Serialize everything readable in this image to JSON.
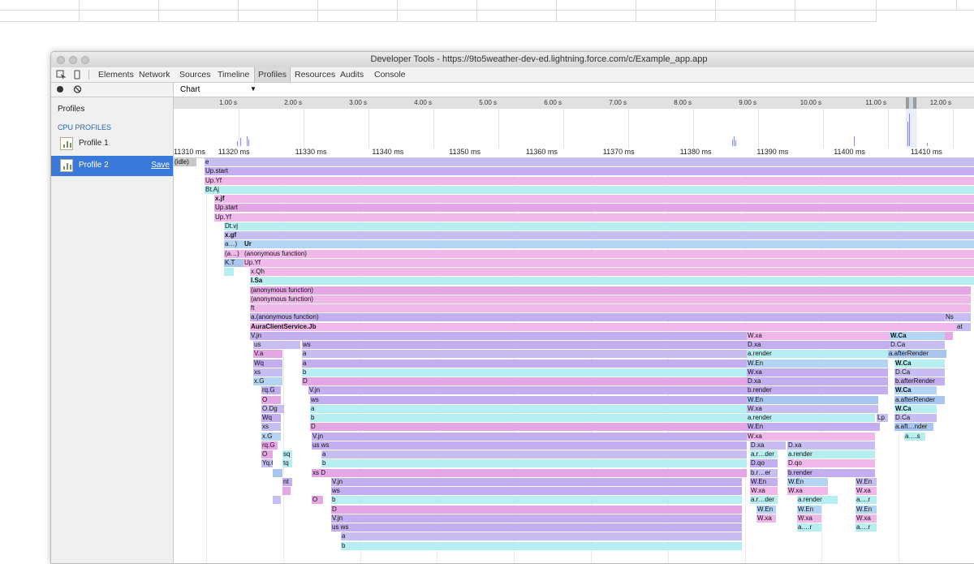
{
  "window": {
    "title": "Developer Tools - https://9to5weather-dev-ed.lightning.force.com/c/Example_app.app"
  },
  "tabs": [
    {
      "label": "Elements",
      "name": "tab-elements"
    },
    {
      "label": "Network",
      "name": "tab-network"
    },
    {
      "label": "Sources",
      "name": "tab-sources"
    },
    {
      "label": "Timeline",
      "name": "tab-timeline"
    },
    {
      "label": "Profiles",
      "name": "tab-profiles",
      "active": true
    },
    {
      "label": "Resources",
      "name": "tab-resources"
    },
    {
      "label": "Audits",
      "name": "tab-audits"
    },
    {
      "label": "Console",
      "name": "tab-console"
    }
  ],
  "sidebar": {
    "profiles_label": "Profiles",
    "cpu_header": "CPU PROFILES",
    "items": [
      {
        "label": "Profile 1"
      },
      {
        "label": "Profile 2",
        "save": "Save"
      }
    ]
  },
  "view": {
    "selected": "Chart"
  },
  "overview": {
    "labels": [
      "1.00 s",
      "2.00 s",
      "3.00 s",
      "4.00 s",
      "5.00 s",
      "6.00 s",
      "7.00 s",
      "8.00 s",
      "9.00 s",
      "10.00 s",
      "11.00 s",
      "12.00 s"
    ]
  },
  "flame_ruler": {
    "labels": [
      "11310 ms",
      "11320 ms",
      "11330 ms",
      "11340 ms",
      "11350 ms",
      "11360 ms",
      "11370 ms",
      "11380 ms",
      "11390 ms",
      "11400 ms",
      "11410 ms"
    ]
  },
  "colors": {
    "lavender": "#c7bdf0",
    "pink": "#f0b8ea",
    "cyan": "#b6eef2",
    "blue": "#b3d4f2",
    "violet": "#c3aef0",
    "magenta": "#e5a6e6",
    "sky": "#a9c6f0",
    "gray": "#c8c8c8"
  },
  "flame": [
    [
      "(idle)",
      0,
      28,
      0,
      "gray"
    ],
    [
      "e",
      38,
      962,
      0,
      "lavender"
    ],
    [
      "Up.start",
      38,
      962,
      1,
      "violet"
    ],
    [
      "Up.Yf",
      38,
      962,
      2,
      "pink"
    ],
    [
      "Bt.Aj",
      38,
      962,
      3,
      "cyan"
    ],
    [
      "x.jf",
      50,
      950,
      4,
      "pink",
      "b"
    ],
    [
      "Up.start",
      50,
      950,
      5,
      "magenta"
    ],
    [
      "Up.Yf",
      50,
      950,
      6,
      "pink"
    ],
    [
      "Dt.vj",
      62,
      938,
      7,
      "cyan"
    ],
    [
      "x.gf",
      62,
      938,
      8,
      "lavender",
      "b"
    ],
    [
      "a…)",
      62,
      24,
      9,
      "blue"
    ],
    [
      "Ur",
      86,
      914,
      9,
      "blue",
      "b"
    ],
    [
      "(a…)",
      62,
      24,
      10,
      "pink"
    ],
    [
      "(anonymous function)",
      86,
      914,
      10,
      "pink"
    ],
    [
      "K.T",
      62,
      24,
      11,
      "sky"
    ],
    [
      "Up.Yf",
      86,
      914,
      11,
      "pink"
    ],
    [
      "",
      62,
      12,
      12,
      "cyan"
    ],
    [
      "x.Qh",
      94,
      906,
      12,
      "pink"
    ],
    [
      "I.Sa",
      94,
      906,
      13,
      "cyan",
      "b"
    ],
    [
      "(anonymous function)",
      94,
      888,
      14,
      "magenta"
    ],
    [
      "(anonymous function)",
      94,
      888,
      15,
      "pink"
    ],
    [
      "ft",
      94,
      888,
      16,
      "pink"
    ],
    [
      "a.(anonymous function)",
      94,
      856,
      17,
      "violet"
    ],
    [
      "Ns",
      950,
      32,
      17,
      "lavender"
    ],
    [
      "AuraClientService.Jb",
      94,
      870,
      18,
      "pink",
      "b"
    ],
    [
      "at",
      964,
      18,
      18,
      "lavender"
    ],
    [
      "V.jn",
      94,
      612,
      19,
      "violet"
    ],
    [
      "W.xa",
      706,
      176,
      19,
      "pink"
    ],
    [
      "W.Ca",
      882,
      68,
      19,
      "blue",
      "b"
    ],
    [
      "",
      950,
      10,
      19,
      "magenta"
    ],
    [
      "us",
      98,
      58,
      20,
      "lavender"
    ],
    [
      "ws",
      158,
      548,
      20,
      "violet"
    ],
    [
      "D.xa",
      706,
      176,
      20,
      "violet"
    ],
    [
      "D.Ca",
      882,
      68,
      20,
      "lavender"
    ],
    [
      "V.a",
      98,
      36,
      21,
      "magenta"
    ],
    [
      "a",
      158,
      548,
      21,
      "lavender"
    ],
    [
      "a.render",
      706,
      174,
      21,
      "cyan"
    ],
    [
      "a.afterRender",
      880,
      72,
      21,
      "sky"
    ],
    [
      "Wq",
      98,
      36,
      22,
      "violet"
    ],
    [
      "a",
      158,
      548,
      22,
      "violet"
    ],
    [
      "W.En",
      706,
      174,
      22,
      "blue"
    ],
    [
      "W.Ca",
      888,
      62,
      22,
      "cyan",
      "b"
    ],
    [
      "xs",
      98,
      36,
      23,
      "lavender"
    ],
    [
      "b",
      158,
      548,
      23,
      "cyan"
    ],
    [
      "W.xa",
      706,
      174,
      23,
      "violet"
    ],
    [
      "D.Ca",
      888,
      62,
      23,
      "lavender"
    ],
    [
      "x.G",
      98,
      36,
      24,
      "blue"
    ],
    [
      "D",
      158,
      548,
      24,
      "magenta"
    ],
    [
      "D.xa",
      706,
      174,
      24,
      "violet"
    ],
    [
      "b.afterRender",
      888,
      62,
      24,
      "violet"
    ],
    [
      "rq.G",
      108,
      24,
      25,
      "violet"
    ],
    [
      "V.jn",
      166,
      540,
      25,
      "violet"
    ],
    [
      "b.render",
      706,
      174,
      25,
      "violet"
    ],
    [
      "W.Ca",
      888,
      52,
      25,
      "blue",
      "b"
    ],
    [
      "O",
      108,
      24,
      26,
      "magenta"
    ],
    [
      "ws",
      168,
      538,
      26,
      "violet"
    ],
    [
      "W.En",
      706,
      162,
      26,
      "sky"
    ],
    [
      "a.afterRender",
      888,
      62,
      26,
      "sky"
    ],
    [
      "O.Dg",
      108,
      28,
      27,
      "lavender"
    ],
    [
      "a",
      168,
      538,
      27,
      "cyan"
    ],
    [
      "W.xa",
      706,
      162,
      27,
      "lavender"
    ],
    [
      "W.Ca",
      888,
      52,
      27,
      "cyan",
      "b"
    ],
    [
      "Wq",
      108,
      24,
      28,
      "violet"
    ],
    [
      "b",
      168,
      538,
      28,
      "cyan"
    ],
    [
      "a.render",
      706,
      158,
      28,
      "cyan"
    ],
    [
      "Lp",
      866,
      14,
      28,
      "lavender"
    ],
    [
      "D.Ca",
      888,
      52,
      28,
      "lavender"
    ],
    [
      "xs",
      108,
      24,
      29,
      "lavender"
    ],
    [
      "D",
      168,
      538,
      29,
      "magenta"
    ],
    [
      "W.En",
      706,
      164,
      29,
      "violet"
    ],
    [
      "a.aft…nder",
      888,
      48,
      29,
      "sky"
    ],
    [
      "x.G",
      108,
      24,
      30,
      "blue"
    ],
    [
      "V.jn",
      170,
      536,
      30,
      "violet"
    ],
    [
      "W.xa",
      706,
      158,
      30,
      "pink"
    ],
    [
      "a….s",
      900,
      26,
      30,
      "cyan"
    ],
    [
      "rq.G",
      108,
      20,
      31,
      "magenta"
    ],
    [
      "us ws",
      170,
      536,
      31,
      "violet"
    ],
    [
      "D.xa",
      710,
      44,
      31,
      "lavender"
    ],
    [
      "D.xa",
      756,
      108,
      31,
      "lavender"
    ],
    [
      "O",
      108,
      14,
      32,
      "magenta"
    ],
    [
      "sq",
      134,
      12,
      32,
      "cyan"
    ],
    [
      "a",
      182,
      524,
      32,
      "lavender"
    ],
    [
      "a.r…der",
      710,
      34,
      32,
      "cyan"
    ],
    [
      "a.render",
      756,
      108,
      32,
      "cyan"
    ],
    [
      "Yq.G",
      108,
      14,
      33,
      "lavender"
    ],
    [
      "tq",
      134,
      12,
      33,
      "cyan"
    ],
    [
      "b",
      182,
      524,
      33,
      "cyan"
    ],
    [
      "D.qo",
      710,
      34,
      33,
      "violet"
    ],
    [
      "D.qo",
      756,
      108,
      33,
      "pink"
    ],
    [
      "",
      122,
      12,
      34,
      "sky"
    ],
    [
      "xs D",
      170,
      536,
      34,
      "magenta"
    ],
    [
      "b.r…er",
      710,
      34,
      34,
      "lavender"
    ],
    [
      "b.render",
      756,
      108,
      34,
      "violet"
    ],
    [
      "nt",
      134,
      12,
      35,
      "violet"
    ],
    [
      "V.jn",
      194,
      506,
      35,
      "violet"
    ],
    [
      "W.En",
      710,
      34,
      35,
      "violet"
    ],
    [
      "W.En",
      756,
      50,
      35,
      "blue"
    ],
    [
      "W.En",
      840,
      26,
      35,
      "lavender"
    ],
    [
      "",
      134,
      10,
      36,
      "magenta"
    ],
    [
      "ws",
      194,
      506,
      36,
      "violet"
    ],
    [
      "W.xa",
      710,
      34,
      36,
      "pink"
    ],
    [
      "W.xa",
      756,
      50,
      36,
      "pink"
    ],
    [
      "W.xa",
      840,
      26,
      36,
      "pink"
    ],
    [
      "",
      122,
      10,
      37,
      "lavender"
    ],
    [
      "O",
      170,
      14,
      37,
      "magenta"
    ],
    [
      "b",
      194,
      506,
      37,
      "cyan"
    ],
    [
      "a.r…der",
      710,
      34,
      37,
      "cyan"
    ],
    [
      "a.render",
      768,
      50,
      37,
      "cyan"
    ],
    [
      "a.…r",
      840,
      26,
      37,
      "cyan"
    ],
    [
      "D",
      194,
      506,
      38,
      "magenta"
    ],
    [
      "W.En",
      718,
      24,
      38,
      "blue"
    ],
    [
      "W.En",
      768,
      30,
      38,
      "blue"
    ],
    [
      "W.En",
      840,
      26,
      38,
      "blue"
    ],
    [
      "V.jn",
      194,
      506,
      39,
      "violet"
    ],
    [
      "W.xa",
      718,
      24,
      39,
      "pink"
    ],
    [
      "W.xa",
      768,
      30,
      39,
      "pink"
    ],
    [
      "W.xa",
      840,
      26,
      39,
      "pink"
    ],
    [
      "us ws",
      194,
      506,
      40,
      "violet"
    ],
    [
      "a.…r",
      768,
      30,
      40,
      "cyan"
    ],
    [
      "a.…r",
      840,
      26,
      40,
      "cyan"
    ],
    [
      "a",
      206,
      494,
      41,
      "lavender"
    ],
    [
      "b",
      206,
      494,
      42,
      "cyan"
    ]
  ]
}
